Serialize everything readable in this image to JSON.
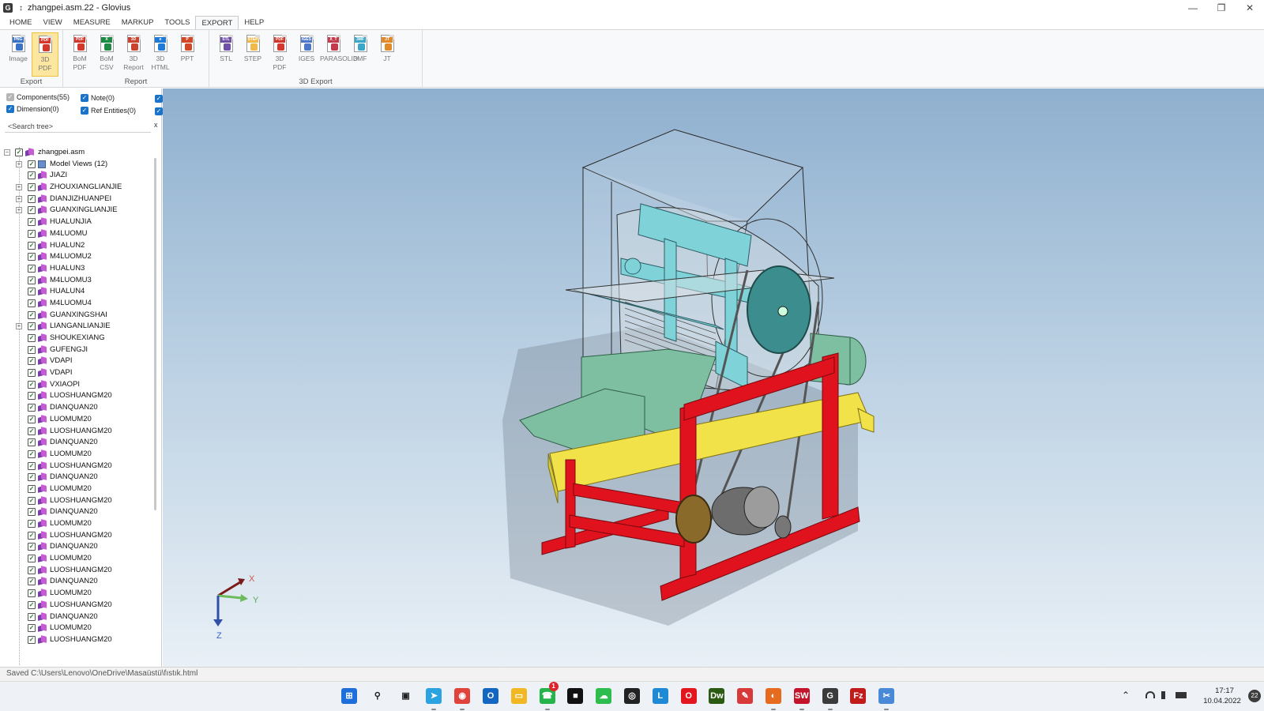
{
  "window": {
    "title": "zhangpei.asm.22 - Glovius",
    "app_icon": "G",
    "pin_symbol": "↕",
    "minimize": "—",
    "maximize": "❐",
    "close": "✕"
  },
  "ribbon_tabs": [
    {
      "label": "HOME",
      "active": false
    },
    {
      "label": "VIEW",
      "active": false
    },
    {
      "label": "MEASURE",
      "active": false
    },
    {
      "label": "MARKUP",
      "active": false
    },
    {
      "label": "TOOLS",
      "active": false
    },
    {
      "label": "EXPORT",
      "active": true
    },
    {
      "label": "HELP",
      "active": false
    }
  ],
  "ribbon": {
    "groups": [
      "Export",
      "Report",
      "3D Export"
    ],
    "export_buttons": [
      {
        "l1": "Image",
        "l2": "",
        "tag": "PNG",
        "icon": "image-export-icon"
      },
      {
        "l1": "3D",
        "l2": "PDF",
        "tag": "PDF",
        "icon": "3d-pdf-icon",
        "active": true
      }
    ],
    "report_buttons": [
      {
        "l1": "BoM",
        "l2": "PDF",
        "tag": "PDF",
        "icon": "bom-pdf-icon"
      },
      {
        "l1": "BoM",
        "l2": "CSV",
        "tag": "X",
        "icon": "bom-csv-icon"
      },
      {
        "l1": "3D",
        "l2": "Report",
        "tag": "3D",
        "icon": "3d-report-icon"
      },
      {
        "l1": "3D",
        "l2": "HTML",
        "tag": "e",
        "icon": "3d-html-icon"
      },
      {
        "l1": "PPT",
        "l2": "",
        "tag": "P",
        "icon": "ppt-icon"
      }
    ],
    "export3d_buttons": [
      {
        "l1": "STL",
        "tag": "STL",
        "icon": "stl-icon"
      },
      {
        "l1": "STEP",
        "tag": "STEP",
        "icon": "step-icon"
      },
      {
        "l1": "3D",
        "l2": "PDF",
        "tag": "PDF",
        "icon": "3d-pdf-export-icon"
      },
      {
        "l1": "IGES",
        "tag": "IGES",
        "icon": "iges-icon"
      },
      {
        "l1": "PARASOLID",
        "tag": "X_T",
        "icon": "parasolid-icon"
      },
      {
        "l1": "3MF",
        "tag": "3MF",
        "icon": "3mf-icon"
      },
      {
        "l1": "JT",
        "tag": "JT",
        "icon": "jt-icon"
      }
    ]
  },
  "filters": {
    "components": "Components(55)",
    "note": "Note(0)",
    "dimension": "Dimension(0)",
    "ref_entities": "Ref Entities(0)"
  },
  "search": {
    "placeholder": "<Search tree>",
    "clear": "x"
  },
  "tree": {
    "root": "zhangpei.asm",
    "model_views": "Model Views (12)",
    "items": [
      {
        "label": "JIAZI",
        "expandable": false
      },
      {
        "label": "ZHOUXIANGLIANJIE",
        "expandable": true
      },
      {
        "label": "DIANJIZHUANPEI",
        "expandable": true
      },
      {
        "label": "GUANXINGLIANJIE",
        "expandable": true
      },
      {
        "label": "HUALUNJIA",
        "expandable": false
      },
      {
        "label": "M4LUOMU",
        "expandable": false
      },
      {
        "label": "HUALUN2",
        "expandable": false
      },
      {
        "label": "M4LUOMU2",
        "expandable": false
      },
      {
        "label": "HUALUN3",
        "expandable": false
      },
      {
        "label": "M4LUOMU3",
        "expandable": false
      },
      {
        "label": "HUALUN4",
        "expandable": false
      },
      {
        "label": "M4LUOMU4",
        "expandable": false
      },
      {
        "label": "GUANXINGSHAI",
        "expandable": false
      },
      {
        "label": "LIANGANLIANJIE",
        "expandable": true
      },
      {
        "label": "SHOUKEXIANG",
        "expandable": false
      },
      {
        "label": "GUFENGJI",
        "expandable": false
      },
      {
        "label": "VDAPI",
        "expandable": false
      },
      {
        "label": "VDAPI",
        "expandable": false
      },
      {
        "label": "VXIAOPI",
        "expandable": false
      },
      {
        "label": "LUOSHUANGM20",
        "expandable": false
      },
      {
        "label": "DIANQUAN20",
        "expandable": false
      },
      {
        "label": "LUOMUM20",
        "expandable": false
      },
      {
        "label": "LUOSHUANGM20",
        "expandable": false
      },
      {
        "label": "DIANQUAN20",
        "expandable": false
      },
      {
        "label": "LUOMUM20",
        "expandable": false
      },
      {
        "label": "LUOSHUANGM20",
        "expandable": false
      },
      {
        "label": "DIANQUAN20",
        "expandable": false
      },
      {
        "label": "LUOMUM20",
        "expandable": false
      },
      {
        "label": "LUOSHUANGM20",
        "expandable": false
      },
      {
        "label": "DIANQUAN20",
        "expandable": false
      },
      {
        "label": "LUOMUM20",
        "expandable": false
      },
      {
        "label": "LUOSHUANGM20",
        "expandable": false
      },
      {
        "label": "DIANQUAN20",
        "expandable": false
      },
      {
        "label": "LUOMUM20",
        "expandable": false
      },
      {
        "label": "LUOSHUANGM20",
        "expandable": false
      },
      {
        "label": "DIANQUAN20",
        "expandable": false
      },
      {
        "label": "LUOMUM20",
        "expandable": false
      },
      {
        "label": "LUOSHUANGM20",
        "expandable": false
      },
      {
        "label": "DIANQUAN20",
        "expandable": false
      },
      {
        "label": "LUOMUM20",
        "expandable": false
      },
      {
        "label": "LUOSHUANGM20",
        "expandable": false
      }
    ]
  },
  "axes": {
    "x": "X",
    "y": "Y",
    "z": "Z"
  },
  "status": {
    "text": "Saved C:\\Users\\Lenovo\\OneDrive\\Masaüstü\\fıstık.html"
  },
  "taskbar": {
    "apps": [
      {
        "name": "start-icon",
        "glyph": "⊞",
        "color": "#1e6fd9"
      },
      {
        "name": "search-icon",
        "glyph": "⚲",
        "color": "#333"
      },
      {
        "name": "task-view-icon",
        "glyph": "▣",
        "color": "#333"
      },
      {
        "name": "telegram-icon",
        "glyph": "➤",
        "color": "#2aa3e0"
      },
      {
        "name": "chrome-icon",
        "glyph": "◉",
        "color": "#e0433b"
      },
      {
        "name": "outlook-icon",
        "glyph": "O",
        "color": "#1366c2"
      },
      {
        "name": "file-explorer-icon",
        "glyph": "▭",
        "color": "#f2b824"
      },
      {
        "name": "whatsapp-icon",
        "glyph": "☎",
        "color": "#25b44a"
      },
      {
        "name": "media-app-icon",
        "glyph": "■",
        "color": "#111"
      },
      {
        "name": "wechat-icon",
        "glyph": "☁",
        "color": "#2dbd4e"
      },
      {
        "name": "obs-icon",
        "glyph": "◎",
        "color": "#222"
      },
      {
        "name": "l-app-icon",
        "glyph": "L",
        "color": "#1e8ad6"
      },
      {
        "name": "opera-icon",
        "glyph": "O",
        "color": "#e3161f"
      },
      {
        "name": "dreamweaver-icon",
        "glyph": "Dw",
        "color": "#2b5a12"
      },
      {
        "name": "paint-app-icon",
        "glyph": "✎",
        "color": "#d83a3a"
      },
      {
        "name": "firefox-icon",
        "glyph": "◐",
        "color": "#e66b1e"
      },
      {
        "name": "solidworks-icon",
        "glyph": "SW",
        "color": "#c3142b"
      },
      {
        "name": "glovius-icon",
        "glyph": "G",
        "color": "#3b3b3b"
      },
      {
        "name": "filezilla-icon",
        "glyph": "Fz",
        "color": "#c21b1b"
      },
      {
        "name": "snipping-tool-icon",
        "glyph": "✂",
        "color": "#4a89d8"
      }
    ],
    "whatsapp_badge": "1",
    "tray_chevron": "⌃",
    "time": "17:17",
    "date": "10.04.2022",
    "notifications": "22"
  }
}
